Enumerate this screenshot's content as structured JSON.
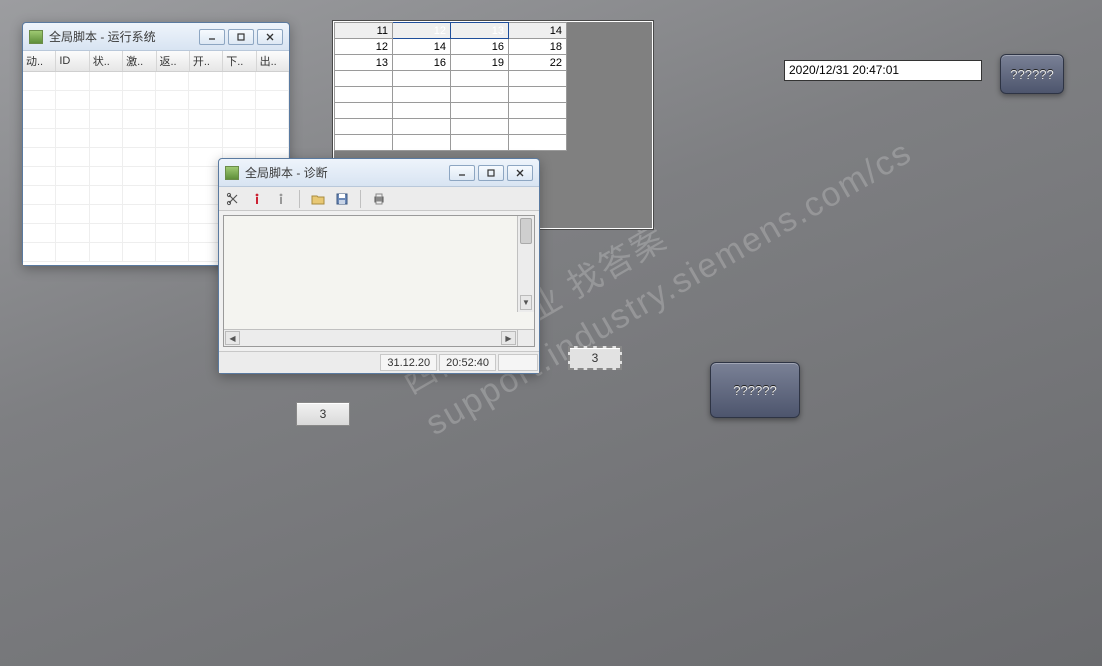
{
  "watermark": {
    "line1": "西门子工业 找答案",
    "line2": "support.industry.siemens.com/cs"
  },
  "runtime_window": {
    "title": "全局脚本 - 运行系统",
    "columns": [
      "动..",
      "ID",
      "状..",
      "激..",
      "返..",
      "开..",
      "下..",
      "出.."
    ]
  },
  "grid": {
    "rows": [
      [
        "11",
        "12",
        "13",
        "14"
      ],
      [
        "12",
        "14",
        "16",
        "18"
      ],
      [
        "13",
        "16",
        "19",
        "22"
      ]
    ],
    "selected": {
      "row": 0,
      "cols": [
        1,
        2
      ]
    },
    "blank_rows": 5
  },
  "diagnostics_window": {
    "title": "全局脚本 - 诊断",
    "status_date": "31.12.20",
    "status_time": "20:52:40"
  },
  "timestamp_field": "2020/12/31 20:47:01",
  "buttons": {
    "b1": "??????",
    "b2": "??????"
  },
  "value_boxes": {
    "v1": "3",
    "v2": "3"
  }
}
